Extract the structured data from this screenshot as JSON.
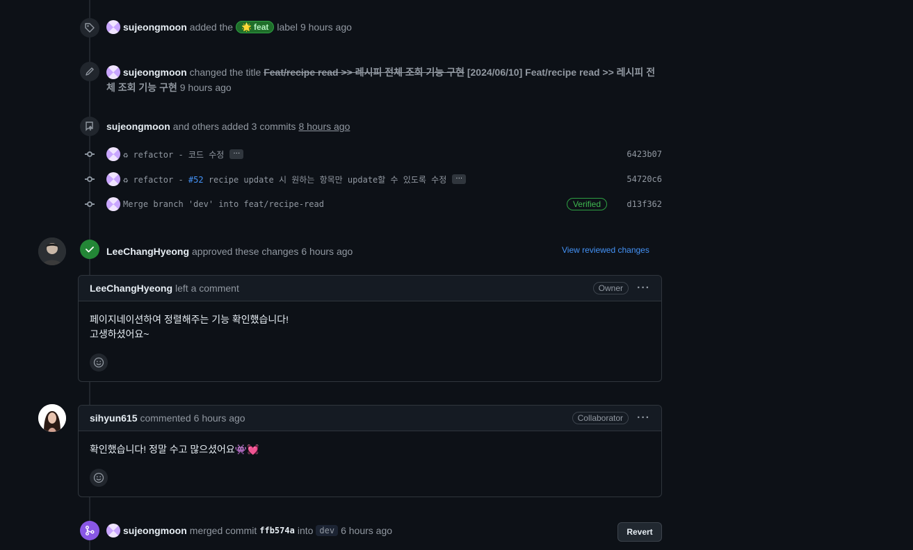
{
  "events": {
    "label_event": {
      "author": "sujeongmoon",
      "action": "added the",
      "label_emoji": "🌟",
      "label_text": "feat",
      "suffix": "label",
      "time": "9 hours ago"
    },
    "rename_event": {
      "author": "sujeongmoon",
      "action": "changed the title",
      "old_title": "Feat/recipe read >> 레시피 전체 조회 기능 구현",
      "new_title_line1": "[2024/06/10] Feat/recipe read >> 레시피 전",
      "new_title_line2": "체 조회 기능 구현",
      "time": "9 hours ago"
    },
    "commits_event": {
      "author": "sujeongmoon",
      "action": "and others added 3 commits",
      "time": "8 hours ago"
    },
    "commits": [
      {
        "message": "♻ refactor - 코드 수정",
        "ellipsis": "···",
        "sha": "6423b07"
      },
      {
        "message_prefix": "♻ refactor - ",
        "issue_ref": "#52",
        "message_suffix": " recipe update 시 원하는 항목만 update할 수 있도록 수정",
        "ellipsis": "···",
        "sha": "54720c6"
      },
      {
        "message": "Merge branch 'dev' into feat/recipe-read",
        "verified": "Verified",
        "sha": "d13f362"
      }
    ],
    "approve_event": {
      "author": "LeeChangHyeong",
      "action": "approved these changes",
      "time": "6 hours ago",
      "link": "View reviewed changes"
    },
    "review_comment": {
      "author": "LeeChangHyeong",
      "action": "left a comment",
      "role": "Owner",
      "kebab": "···",
      "body_line1": "페이지네이션하여 정렬해주는 기능 확인했습니다!",
      "body_line2": "고생하셨어요~"
    },
    "comment": {
      "author": "sihyun615",
      "action": "commented",
      "time": "6 hours ago",
      "role": "Collaborator",
      "kebab": "···",
      "body": "확인했습니다! 정말 수고 많으셨어요👾💓"
    },
    "merge_event": {
      "author": "sujeongmoon",
      "action": "merged commit",
      "commit": "ffb574a",
      "into": "into",
      "branch": "dev",
      "time": "6 hours ago",
      "revert_label": "Revert"
    }
  },
  "icons": {
    "label": "tag-icon",
    "rename": "pencil-icon",
    "commits": "repo-push-icon",
    "commit_node": "git-commit-icon",
    "approved": "check-icon",
    "merged": "git-merge-icon",
    "reaction": "smiley-icon"
  },
  "colors": {
    "background": "#0d1117",
    "approved": "#238636",
    "merged": "#8957e5",
    "link": "#4493f8",
    "verified": "#3fb950"
  }
}
